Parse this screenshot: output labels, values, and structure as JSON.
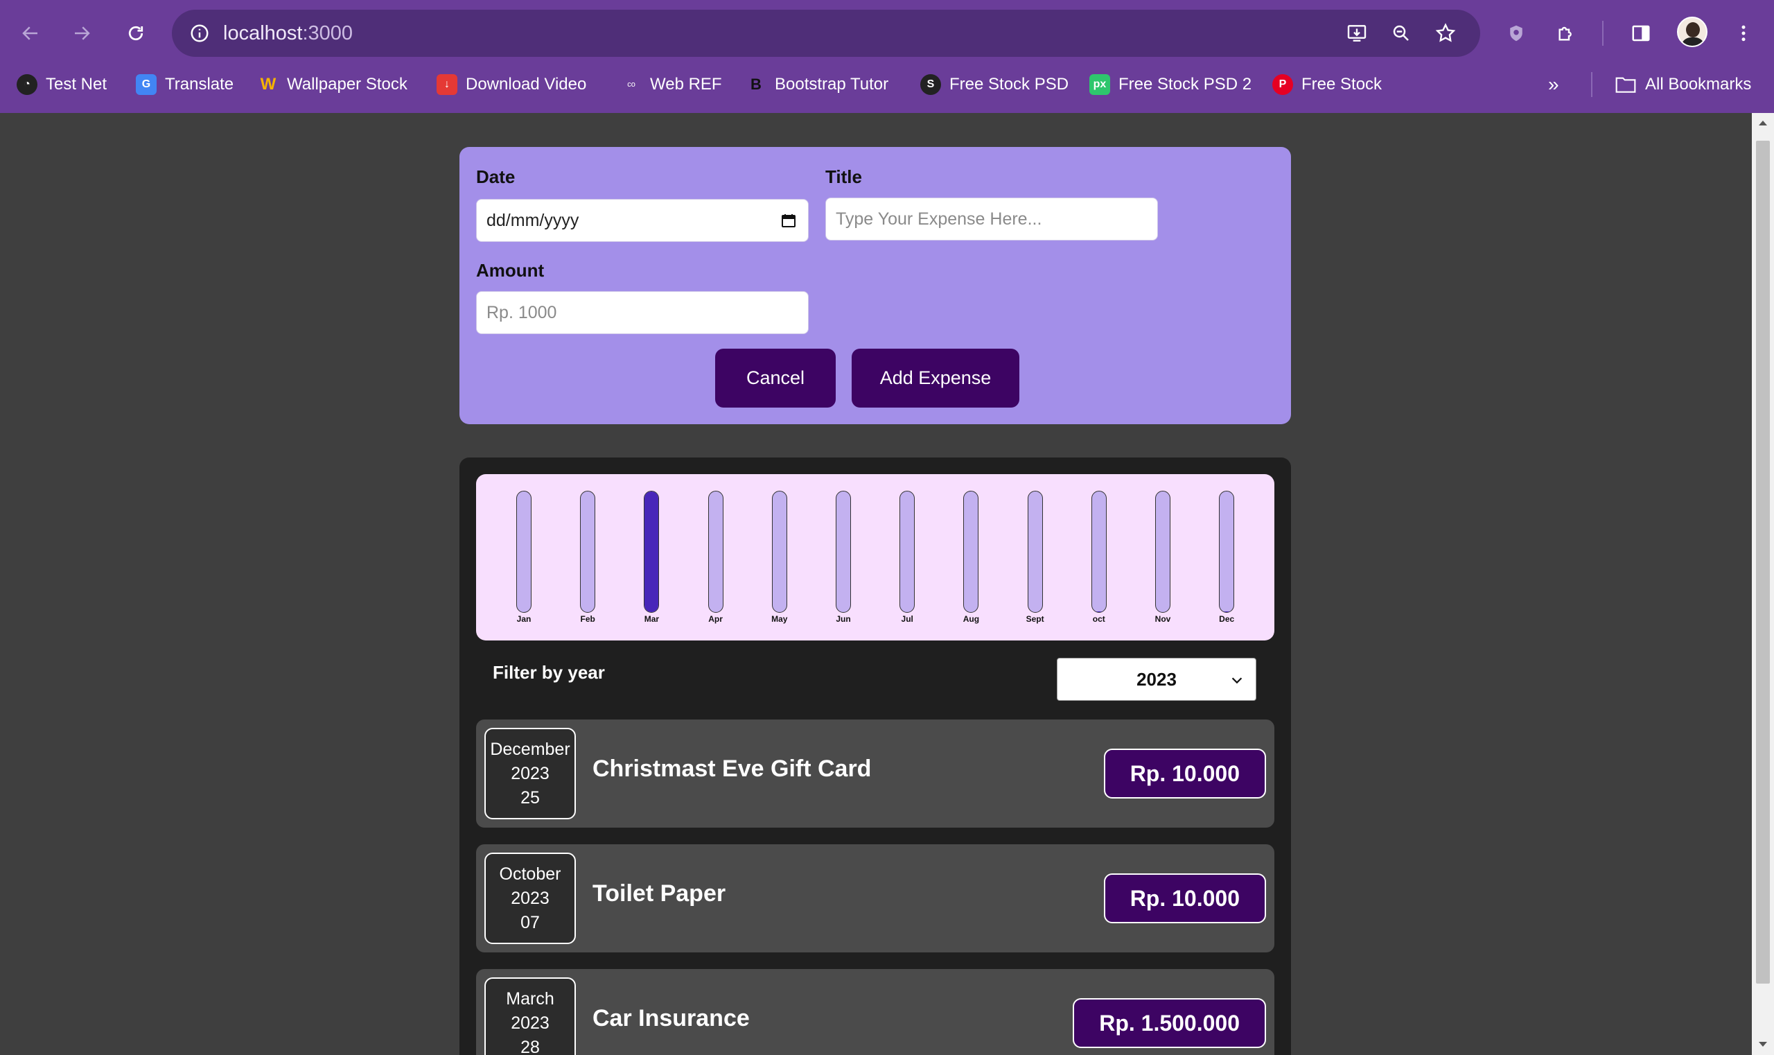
{
  "browser": {
    "url_host": "localhost",
    "url_port": ":3000",
    "bookmarks": [
      {
        "label": "Test Net",
        "icon": "gauge-icon",
        "color": "#222222"
      },
      {
        "label": "Translate",
        "icon": "translate-icon",
        "color": "#4285f4"
      },
      {
        "label": "Wallpaper Stock",
        "icon": "wallpaper-icon",
        "color": "#6a3d99"
      },
      {
        "label": "Download Video",
        "icon": "download-video-icon",
        "color": "#e53935"
      },
      {
        "label": "Web REF",
        "icon": "coloris-icon",
        "color": "#6a3d99"
      },
      {
        "label": "Bootstrap Tutor",
        "icon": "bootstrap-icon",
        "color": "#6a3d99"
      },
      {
        "label": "Free Stock PSD",
        "icon": "freestock-icon",
        "color": "#222222"
      },
      {
        "label": "Free Stock PSD 2",
        "icon": "pixabay-icon",
        "color": "#2ec66d"
      },
      {
        "label": "Free Stock",
        "icon": "pinterest-icon",
        "color": "#e60023"
      }
    ],
    "all_bookmarks": "All Bookmarks"
  },
  "form": {
    "date_label": "Date",
    "date_value": "dd/mm/yyyy",
    "title_label": "Title",
    "title_placeholder": "Type Your Expense Here...",
    "amount_label": "Amount",
    "amount_placeholder": "Rp. 1000",
    "cancel_label": "Cancel",
    "add_label": "Add Expense"
  },
  "chart_data": {
    "type": "bar",
    "categories": [
      "Jan",
      "Feb",
      "Mar",
      "Apr",
      "May",
      "Jun",
      "Jul",
      "Aug",
      "Sept",
      "oct",
      "Nov",
      "Dec"
    ],
    "values": [
      0,
      0,
      1500000,
      0,
      0,
      0,
      0,
      0,
      0,
      10000,
      0,
      10000
    ],
    "max": 1500000
  },
  "filter": {
    "label": "Filter by year",
    "selected": "2023"
  },
  "expenses": [
    {
      "month": "December",
      "year": "2023",
      "day": "25",
      "title": "Christmast Eve Gift Card",
      "amount": "Rp. 10.000"
    },
    {
      "month": "October",
      "year": "2023",
      "day": "07",
      "title": "Toilet Paper",
      "amount": "Rp. 10.000"
    },
    {
      "month": "March",
      "year": "2023",
      "day": "28",
      "title": "Car Insurance",
      "amount": "Rp. 1.500.000"
    }
  ]
}
